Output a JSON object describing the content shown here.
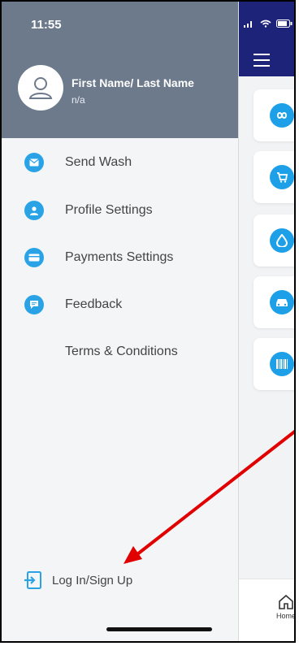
{
  "status": {
    "time": "11:55"
  },
  "profile": {
    "name": "First Name/ Last Name",
    "subtitle": "n/a"
  },
  "menu": {
    "items": [
      {
        "label": "Send Wash",
        "icon": "mail-icon"
      },
      {
        "label": "Profile Settings",
        "icon": "person-icon"
      },
      {
        "label": "Payments Settings",
        "icon": "card-icon"
      },
      {
        "label": "Feedback",
        "icon": "chat-icon"
      },
      {
        "label": "Terms & Conditions",
        "icon": ""
      }
    ]
  },
  "login": {
    "label": "Log In/Sign Up"
  },
  "tabbar": {
    "home_label": "Home"
  },
  "colors": {
    "drawer_header": "#6c7a8c",
    "accent_blue": "#2aa3e6",
    "top_bar": "#1e237a",
    "annotation_red": "#e00000"
  }
}
